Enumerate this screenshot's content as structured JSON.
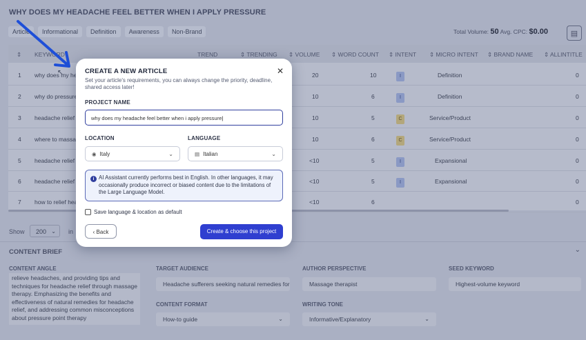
{
  "page": {
    "title": "WHY DOES MY HEADACHE FEEL BETTER WHEN I APPLY PRESSURE",
    "filters": [
      "Article",
      "Informational",
      "Definition",
      "Awareness",
      "Non-Brand"
    ],
    "total_volume_label": "Total Volume:",
    "total_volume": "50",
    "avg_cpc_label": "Avg. CPC:",
    "avg_cpc": "$0.00"
  },
  "table": {
    "headers": [
      "KEYWORD",
      "TREND",
      "TRENDING",
      "VOLUME",
      "WORD COUNT",
      "INTENT",
      "MICRO INTENT",
      "BRAND NAME",
      "ALLINTITLE"
    ],
    "rows": [
      {
        "n": "1",
        "keyword": "why does my hea",
        "volume": "20",
        "wc": "10",
        "intent": "I",
        "micro": "Definition",
        "allintitle": "0"
      },
      {
        "n": "2",
        "keyword": "why do pressure",
        "volume": "10",
        "wc": "6",
        "intent": "I",
        "micro": "Definition",
        "allintitle": "0"
      },
      {
        "n": "3",
        "keyword": "headache relief w",
        "volume": "10",
        "wc": "5",
        "intent": "C",
        "micro": "Service/Product",
        "allintitle": "0"
      },
      {
        "n": "4",
        "keyword": "where to massag",
        "volume": "10",
        "wc": "6",
        "intent": "C",
        "micro": "Service/Product",
        "allintitle": "0"
      },
      {
        "n": "5",
        "keyword": "headache relief v",
        "volume": "<10",
        "wc": "5",
        "intent": "I",
        "micro": "Expansional",
        "allintitle": "0"
      },
      {
        "n": "6",
        "keyword": "headache relief v",
        "volume": "<10",
        "wc": "5",
        "intent": "I",
        "micro": "Expansional",
        "allintitle": "0"
      },
      {
        "n": "7",
        "keyword": "how to relief hea",
        "volume": "<10",
        "wc": "6",
        "intent": "",
        "micro": "",
        "allintitle": "0"
      }
    ]
  },
  "pagination": {
    "show_label": "Show",
    "page_size": "200",
    "in_label": "in"
  },
  "brief": {
    "title": "CONTENT BRIEF",
    "angle_label": "CONTENT ANGLE",
    "angle_text": "relieve headaches, and providing tips and techniques for headache relief through massage therapy. Emphasizing the benefits and effectiveness of natural remedies for headache relief, and addressing common misconceptions about pressure point therapy",
    "audience_label": "TARGET AUDIENCE",
    "audience_value": "Headache sufferers seeking natural remedies for",
    "author_label": "AUTHOR PERSPECTIVE",
    "author_value": "Massage therapist",
    "seed_label": "SEED KEYWORD",
    "seed_value": "Highest-volume keyword",
    "format_label": "CONTENT FORMAT",
    "format_value": "How-to guide",
    "tone_label": "WRITING TONE",
    "tone_value": "Informative/Explanatory"
  },
  "modal": {
    "title": "CREATE A NEW ARTICLE",
    "description": "Set your article's requirements, you can always change the priority, deadline, shared access later!",
    "project_label": "PROJECT NAME",
    "project_value": "why does my headache feel better when i apply pressure",
    "location_label": "LOCATION",
    "location_value": "Italy",
    "language_label": "LANGUAGE",
    "language_value": "Italian",
    "info_text": "AI Assistant currently performs best in English. In other languages, it may occasionally produce incorrect or biased content due to the limitations of the Large Language Model.",
    "checkbox_label": "Save language & location as default",
    "back_label": "Back",
    "create_label": "Create & choose this project"
  },
  "colors": {
    "primary": "#2f3fd0",
    "overlay": "#aab0c3",
    "info_border": "#5b6ab7"
  },
  "icons": [
    "filter-icon",
    "close-icon",
    "location-pin-icon",
    "language-icon",
    "info-icon",
    "chevron-down-icon",
    "back-chevron-icon",
    "sort-icon",
    "arrow-annotation-icon",
    "cursor-icon"
  ]
}
